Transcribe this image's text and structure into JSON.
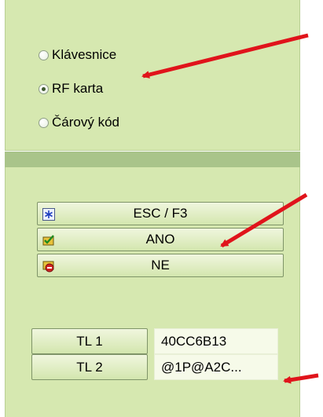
{
  "input_mode": {
    "options": [
      {
        "label": "Klávesnice",
        "selected": false
      },
      {
        "label": "RF karta",
        "selected": true
      },
      {
        "label": "Čárový kód",
        "selected": false
      }
    ]
  },
  "actions": {
    "esc": {
      "label": "ESC / F3",
      "icon": "asterisk-icon"
    },
    "yes": {
      "label": "ANO",
      "icon": "confirm-icon"
    },
    "no": {
      "label": "NE",
      "icon": "cancel-icon"
    }
  },
  "tl": [
    {
      "label": "TL 1",
      "value": "40CC6B13"
    },
    {
      "label": "TL 2",
      "value": "@1P@A2C..."
    }
  ],
  "colors": {
    "panel": "#d6e8b0",
    "divider": "#a9c48a",
    "arrow": "#e0141b"
  }
}
